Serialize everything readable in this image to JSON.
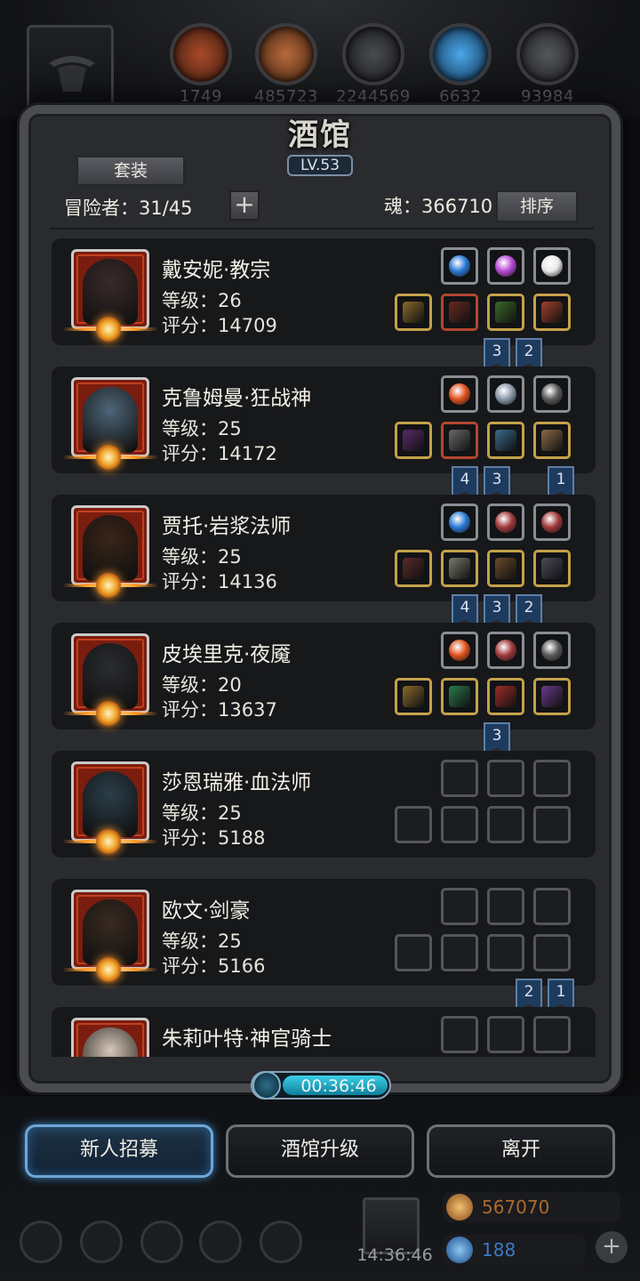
{
  "top": {
    "resources": [
      {
        "icon": "meat-icon",
        "value": "1749",
        "color": "#7a2818"
      },
      {
        "icon": "wood-icon",
        "value": "485723",
        "color": "#6b3a1a"
      },
      {
        "icon": "iron-icon",
        "value": "2244569",
        "color": "#2b2c30"
      },
      {
        "icon": "crystal-icon",
        "value": "6632",
        "color": "#1d4e82"
      },
      {
        "icon": "stone-icon",
        "value": "93984",
        "color": "#2f3033"
      }
    ]
  },
  "panel": {
    "title": "酒馆",
    "level": "LV.53",
    "set_label": "套装",
    "adventurers_label": "冒险者：31/45",
    "soul_label": "魂：366710",
    "sort_label": "排序"
  },
  "heroes": [
    {
      "name": "戴安妮·教宗",
      "level": "等级：26",
      "score": "评分：14709",
      "face": "#3b2a2a",
      "gems": [
        "#2a7bd6",
        "#b64ad6",
        "#e8e8e8"
      ],
      "gear": [
        "#8a6a2a",
        "#6a2a20",
        "#3a6a2a",
        "#a0402a"
      ],
      "flags": [
        "3",
        "2"
      ]
    },
    {
      "name": "克鲁姆曼·狂战神",
      "level": "等级：25",
      "score": "评分：14172",
      "face": "#4d6678",
      "gems": [
        "#e0531f",
        "#8a9aa8",
        "#5a5a5a"
      ],
      "gear": [
        "#5a2a6a",
        "#6a6a6a",
        "#3a6a8a",
        "#8a6a4a"
      ],
      "flags": [
        "4",
        "3",
        "1"
      ]
    },
    {
      "name": "贾托·岩浆法师",
      "level": "等级：25",
      "score": "评分：14136",
      "face": "#3a2418",
      "gems": [
        "#2a7bd6",
        "#a03a3a",
        "#a03a3a"
      ],
      "gear": [
        "#5a2a2a",
        "#7a7a6a",
        "#6a4a2a",
        "#4a4a5a"
      ],
      "flags": [
        "4",
        "3",
        "2"
      ]
    },
    {
      "name": "皮埃里克·夜魇",
      "level": "等级：20",
      "score": "评分：13637",
      "face": "#2a2c30",
      "gems": [
        "#e0531f",
        "#a03a3a",
        "#5a5a5a"
      ],
      "gear": [
        "#8a6a2a",
        "#2a7a4a",
        "#a02a2a",
        "#6a3a8a"
      ],
      "flags": [
        "3"
      ]
    },
    {
      "name": "莎恩瑞雅·血法师",
      "level": "等级：25",
      "score": "评分：5188",
      "face": "#2a3e4a",
      "gems": [],
      "gear": [],
      "flags": []
    },
    {
      "name": "欧文·剑豪",
      "level": "等级：25",
      "score": "评分：5166",
      "face": "#3a2a20",
      "gems": [],
      "gear": [],
      "flags": [
        "2",
        "1"
      ]
    },
    {
      "name": "朱莉叶特·神官骑士",
      "level": "",
      "score": "",
      "face": "#d8c8b8",
      "gems": [],
      "gear": [],
      "flags": []
    }
  ],
  "timer": "00:36:46",
  "buttons": {
    "recruit": "新人招募",
    "upgrade": "酒馆升级",
    "leave": "离开"
  },
  "bottom": {
    "gift_time": "14:36:46",
    "gold": "567070",
    "gems": "188",
    "gold_color": "#e0a050",
    "gem_color": "#3a8ad6"
  }
}
